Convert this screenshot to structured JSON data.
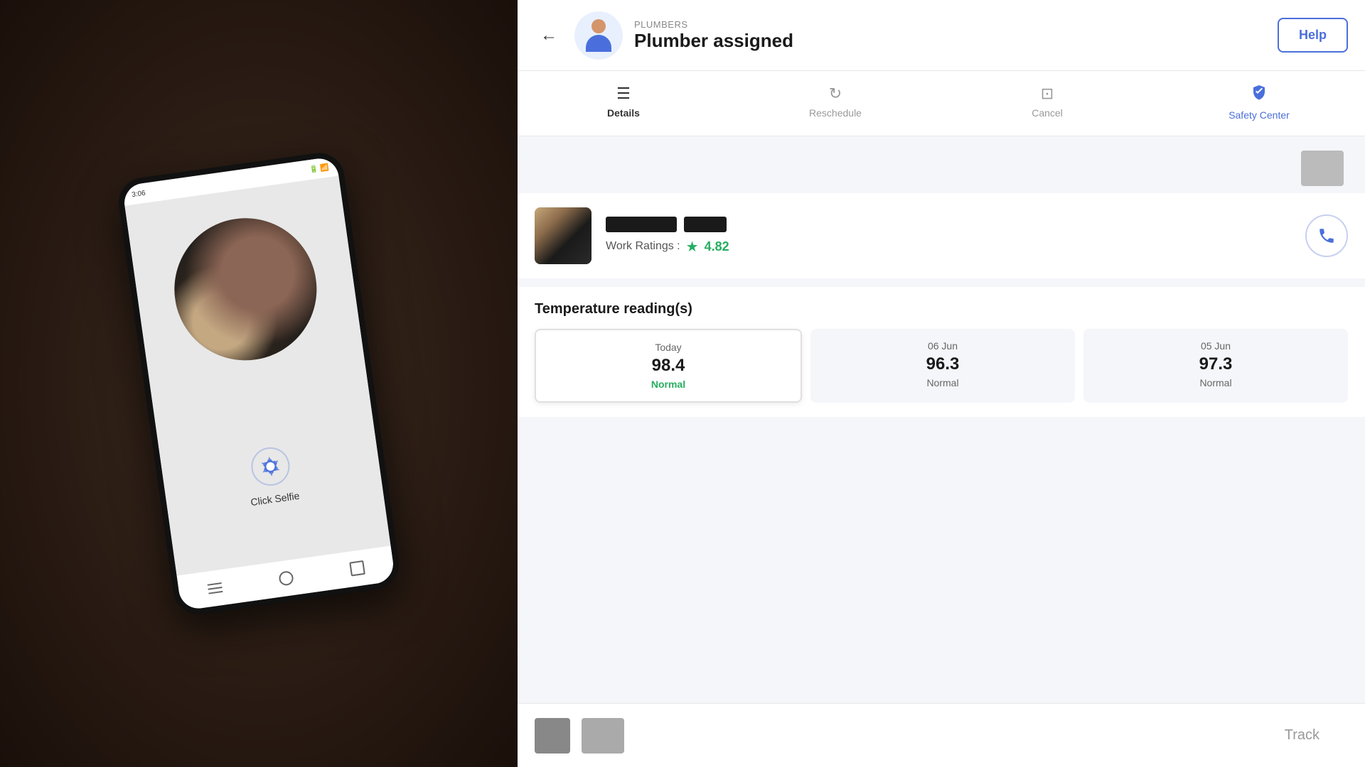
{
  "left": {
    "phone": {
      "status_time": "3:06",
      "click_selfie_label": "Click Selfie"
    }
  },
  "header": {
    "back_label": "←",
    "category": "PLUMBERS",
    "title": "Plumber assigned",
    "help_label": "Help"
  },
  "tabs": [
    {
      "id": "details",
      "label": "Details",
      "icon": "☰",
      "active": true
    },
    {
      "id": "reschedule",
      "label": "Reschedule",
      "icon": "↻",
      "active": false
    },
    {
      "id": "cancel",
      "label": "Cancel",
      "icon": "⊠",
      "active": false
    },
    {
      "id": "safety",
      "label": "Safety Center",
      "icon": "🛡",
      "active": false
    }
  ],
  "plumber": {
    "work_ratings_label": "Work Ratings :",
    "rating": "4.82"
  },
  "temperature": {
    "section_title": "Temperature reading(s)",
    "readings": [
      {
        "date": "Today",
        "value": "98.4",
        "status": "Normal",
        "active": true
      },
      {
        "date": "06 Jun",
        "value": "96.3",
        "status": "Normal",
        "active": false
      },
      {
        "date": "05 Jun",
        "value": "97.3",
        "status": "Normal",
        "active": false
      }
    ]
  },
  "bottom": {
    "track_label": "Track"
  }
}
